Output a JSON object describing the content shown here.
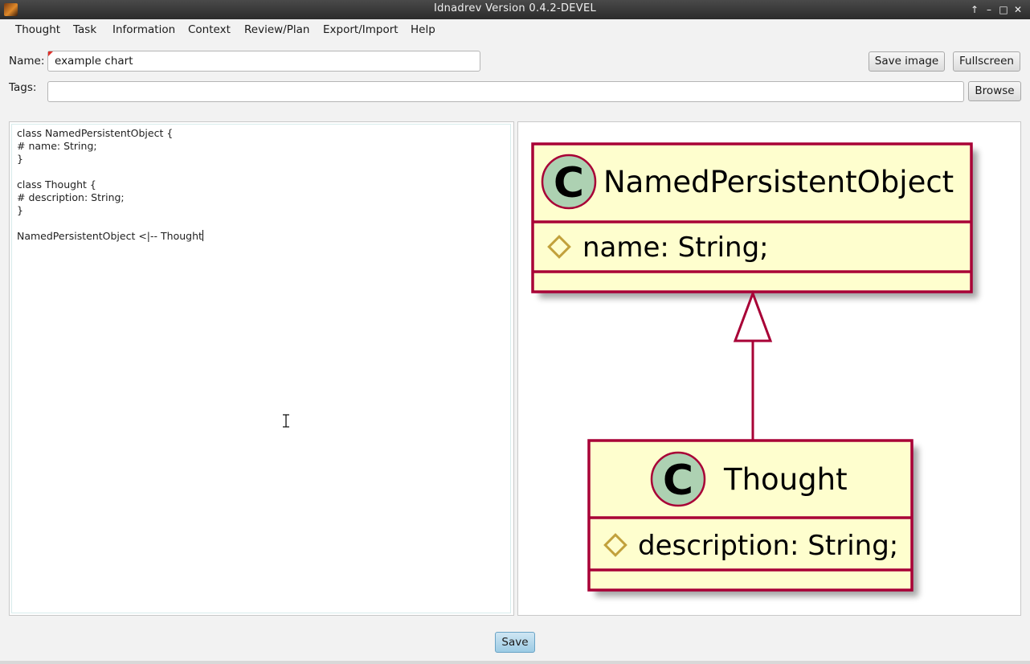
{
  "window": {
    "title": "Idnadrev Version 0.4.2-DEVEL",
    "controls": {
      "up": "↑",
      "minimize": "–",
      "maximize": "□",
      "close": "✕"
    }
  },
  "menu": [
    "Thought",
    "Task",
    "Information",
    "Context",
    "Review/Plan",
    "Export/Import",
    "Help"
  ],
  "form": {
    "name_label": "Name:",
    "name_value": "example chart",
    "tags_label": "Tags:",
    "tags_value": "",
    "save_image_label": "Save image",
    "fullscreen_label": "Fullscreen",
    "browse_label": "Browse"
  },
  "editor": {
    "lines": [
      "class NamedPersistentObject {",
      "# name: String;",
      "}",
      "",
      "class Thought {",
      "# description: String;",
      "}",
      "",
      "NamedPersistentObject <|-- Thought"
    ]
  },
  "diagram": {
    "classes": [
      {
        "badge": "C",
        "name": "NamedPersistentObject",
        "attribute": "name: String;"
      },
      {
        "badge": "C",
        "name": "Thought",
        "attribute": "description: String;"
      }
    ],
    "colors": {
      "box_fill": "#fefece",
      "border": "#a80036",
      "badge_fill": "#add1b2",
      "attr_icon": "#c2a13c"
    }
  },
  "footer": {
    "save_label": "Save"
  }
}
